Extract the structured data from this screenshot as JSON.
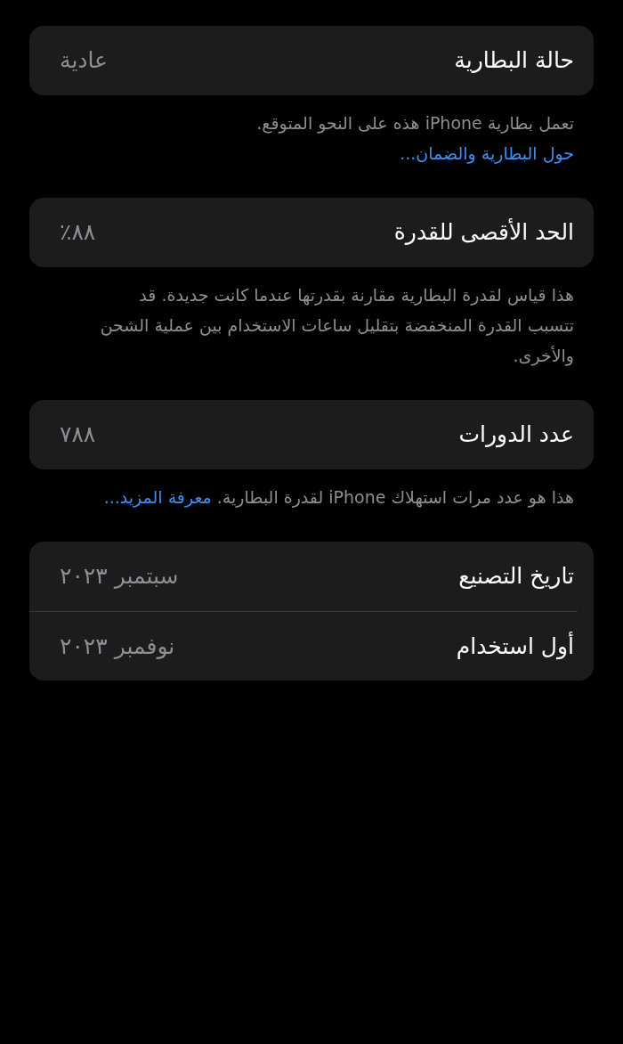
{
  "sections": [
    {
      "rows": [
        {
          "label": "حالة البطارية",
          "value": "عادية"
        }
      ],
      "footer": {
        "text": "تعمل بطارية iPhone هذه على النحو المتوقع.",
        "link": "حول البطارية والضمان..."
      }
    },
    {
      "rows": [
        {
          "label": "الحد الأقصى للقدرة",
          "value": "٨٨٪"
        }
      ],
      "footer": {
        "text": "هذا قياس لقدرة البطارية مقارنة بقدرتها عندما كانت جديدة. قد تتسبب القدرة المنخفضة بتقليل ساعات الاستخدام بين عملية الشحن والأخرى."
      }
    },
    {
      "rows": [
        {
          "label": "عدد الدورات",
          "value": "٧٨٨"
        }
      ],
      "footer": {
        "text": "هذا هو عدد مرات استهلاك iPhone لقدرة البطارية.",
        "link": "معرفة المزيد..."
      }
    },
    {
      "rows": [
        {
          "label": "تاريخ التصنيع",
          "value": "سبتمبر ٢٠٢٣"
        },
        {
          "label": "أول استخدام",
          "value": "نوفمبر ٢٠٢٣"
        }
      ]
    }
  ]
}
